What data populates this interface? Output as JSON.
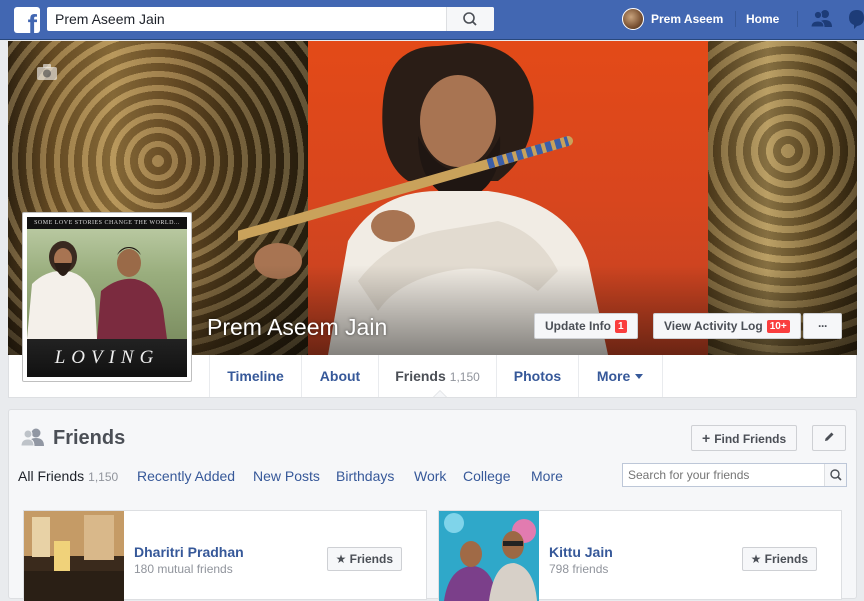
{
  "topbar": {
    "logo": "f",
    "search_value": "Prem Aseem Jain",
    "user_name": "Prem Aseem",
    "home_label": "Home",
    "icons": [
      "facebook-logo-icon",
      "search-icon",
      "avatar",
      "friend-requests-icon",
      "messenger-icon"
    ]
  },
  "profile": {
    "name": "Prem Aseem Jain",
    "pic_tagline": "SOME LOVE STORIES CHANGE THE WORLD...",
    "pic_caption": "LOVING",
    "update_info_label": "Update Info",
    "update_info_badge": "1",
    "activity_log_label": "View Activity Log",
    "activity_log_badge": "10+",
    "more_label": "···"
  },
  "tabs": [
    {
      "label": "Timeline"
    },
    {
      "label": "About"
    },
    {
      "label": "Friends",
      "count": "1,150"
    },
    {
      "label": "Photos"
    },
    {
      "label": "More"
    }
  ],
  "friends": {
    "title": "Friends",
    "find_friends_label": "Find Friends",
    "subtabs": [
      {
        "label": "All Friends",
        "count": "1,150"
      },
      {
        "label": "Recently Added"
      },
      {
        "label": "New Posts"
      },
      {
        "label": "Birthdays"
      },
      {
        "label": "Work"
      },
      {
        "label": "College"
      },
      {
        "label": "More"
      }
    ],
    "search_placeholder": "Search for your friends",
    "cards": [
      {
        "name": "Dharitri Pradhan",
        "sub": "180 mutual friends",
        "button": "Friends"
      },
      {
        "name": "Kittu Jain",
        "sub": "798 friends",
        "button": "Friends"
      }
    ]
  },
  "colors": {
    "brand_blue": "#4267b2",
    "link_blue": "#365899",
    "badge_red": "#fa3e3e"
  }
}
